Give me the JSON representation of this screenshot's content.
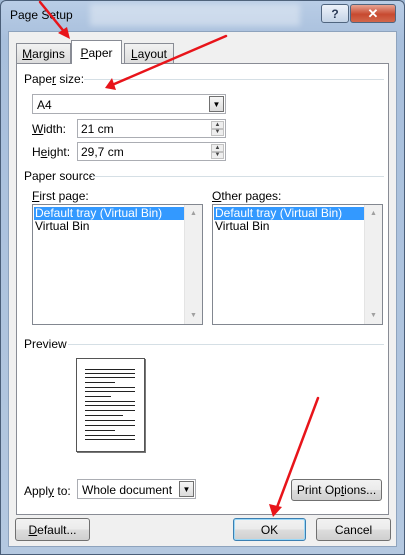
{
  "window": {
    "title": "Page Setup",
    "help_glyph": "?",
    "close_glyph": "✕"
  },
  "tabs": [
    {
      "label_pre": "",
      "label_u": "M",
      "label_post": "argins",
      "active": false
    },
    {
      "label_pre": "",
      "label_u": "P",
      "label_post": "aper",
      "active": true
    },
    {
      "label_pre": "",
      "label_u": "L",
      "label_post": "ayout",
      "active": false
    }
  ],
  "paper_size": {
    "heading_pre": "Pape",
    "heading_u": "r",
    "heading_post": " size:",
    "selected": "A4",
    "width": {
      "label_u": "W",
      "label_post": "idth:",
      "value": "21 cm"
    },
    "height": {
      "label_pre": "H",
      "label_u": "e",
      "label_post": "ight:",
      "value": "29,7 cm"
    }
  },
  "paper_source": {
    "heading": "Paper source",
    "first_page": {
      "label_pre": "",
      "label_u": "F",
      "label_post": "irst page:",
      "items": [
        "Default tray (Virtual Bin)",
        "Virtual Bin"
      ],
      "selected_index": 0
    },
    "other_pages": {
      "label_pre": "",
      "label_u": "O",
      "label_post": "ther pages:",
      "items": [
        "Default tray (Virtual Bin)",
        "Virtual Bin"
      ],
      "selected_index": 0
    }
  },
  "preview": {
    "heading": "Preview",
    "apply_to": {
      "label_pre": "Appl",
      "label_u": "y",
      "label_post": " to:",
      "selected": "Whole document"
    }
  },
  "buttons": {
    "print_options": {
      "pre": "Print Op",
      "u": "t",
      "post": "ions..."
    },
    "default": {
      "pre": "",
      "u": "D",
      "post": "efault..."
    },
    "ok": "OK",
    "cancel": "Cancel"
  },
  "colors": {
    "annotation_arrow": "#e8141a",
    "selection": "#3399ff"
  },
  "icons": {
    "combo_arrow": "▼",
    "spin_up": "▲",
    "spin_down": "▼"
  }
}
